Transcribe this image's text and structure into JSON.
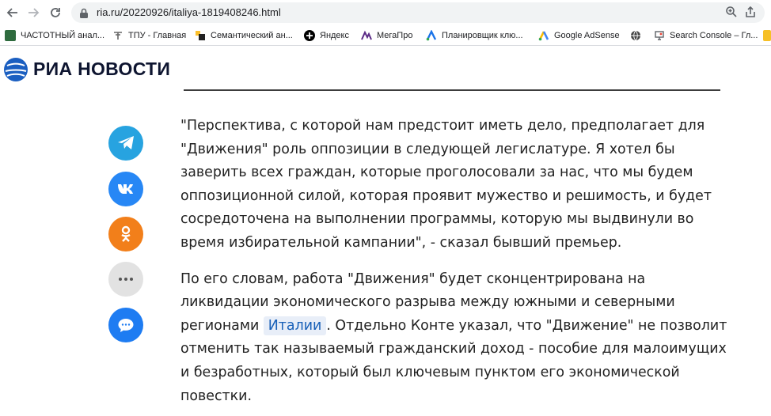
{
  "browser": {
    "url": "ria.ru/20220926/italiya-1819408246.html",
    "bookmarks": [
      {
        "label": "ЧАСТОТНЫЙ анал...",
        "icon": "chastotny-favicon",
        "color": "#2e6b3e"
      },
      {
        "label": "ТПУ - Главная",
        "icon": "tpu-favicon",
        "color": "#666666"
      },
      {
        "label": "Семантический ан...",
        "icon": "semantic-favicon",
        "color": "#d84315"
      },
      {
        "label": "Яндекс",
        "icon": "yandex-favicon",
        "color": "#000000"
      },
      {
        "label": "МегаПро",
        "icon": "megapro-favicon",
        "color": "#5b2a86"
      },
      {
        "label": "Планировщик клю...",
        "icon": "google-ads-favicon",
        "color": "#1a73e8"
      },
      {
        "label": "Google AdSense",
        "icon": "adsense-favicon",
        "color": "#fbbc04"
      },
      {
        "label": "",
        "icon": "globe-favicon",
        "color": "#444444"
      },
      {
        "label": "Search Console – Гл...",
        "icon": "search-console-favicon",
        "color": "#5f6368"
      }
    ]
  },
  "site": {
    "logo_text": "РИА НОВОСТИ"
  },
  "share": {
    "telegram_color": "#27a3e0",
    "vk_color": "#2787f5",
    "ok_color": "#f27f1a",
    "more_color": "#e2e2e2",
    "comments_color": "#1e7cf2"
  },
  "article": {
    "para1": "\"Перспектива, с которой нам предстоит иметь дело, предполагает для \"Движения\" роль оппозиции в следующей легислатуре. Я хотел бы заверить всех граждан, которые проголосовали за нас, что мы будем оппозиционной силой, которая проявит мужество и решимость, и будет сосредоточена на выполнении программы, которую мы выдвинули во время избирательной кампании\", - сказал бывший премьер.",
    "para2_before": "По его словам, работа \"Движения\" будет сконцентрирована на ликвидации экономического разрыва между южными и северными регионами ",
    "para2_link": "Италии",
    "para2_after": ". Отдельно Конте указал, что \"Движение\" не позволит отменить так называемый гражданский доход - пособие для малоимущих и безработных, который был ключевым пунктом его экономической повестки."
  }
}
